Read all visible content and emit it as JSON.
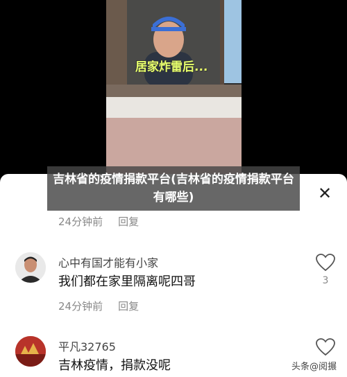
{
  "video": {
    "caption": "居家炸雷后..."
  },
  "title_overlay": "吉林省的疫情捐款平台(吉林省的疫情捐款平台有哪些)",
  "close_icon": "close-icon",
  "comments": [
    {
      "time": "24分钟前",
      "reply_label": "回复"
    },
    {
      "username": "心中有国才能有小家",
      "text": "我们都在家里隔离呢四哥",
      "likes": "3",
      "time": "24分钟前",
      "reply_label": "回复"
    },
    {
      "username": "平凡32765",
      "text": "吉林疫情，捐款没呢"
    }
  ],
  "watermark": "头条@阅搌"
}
